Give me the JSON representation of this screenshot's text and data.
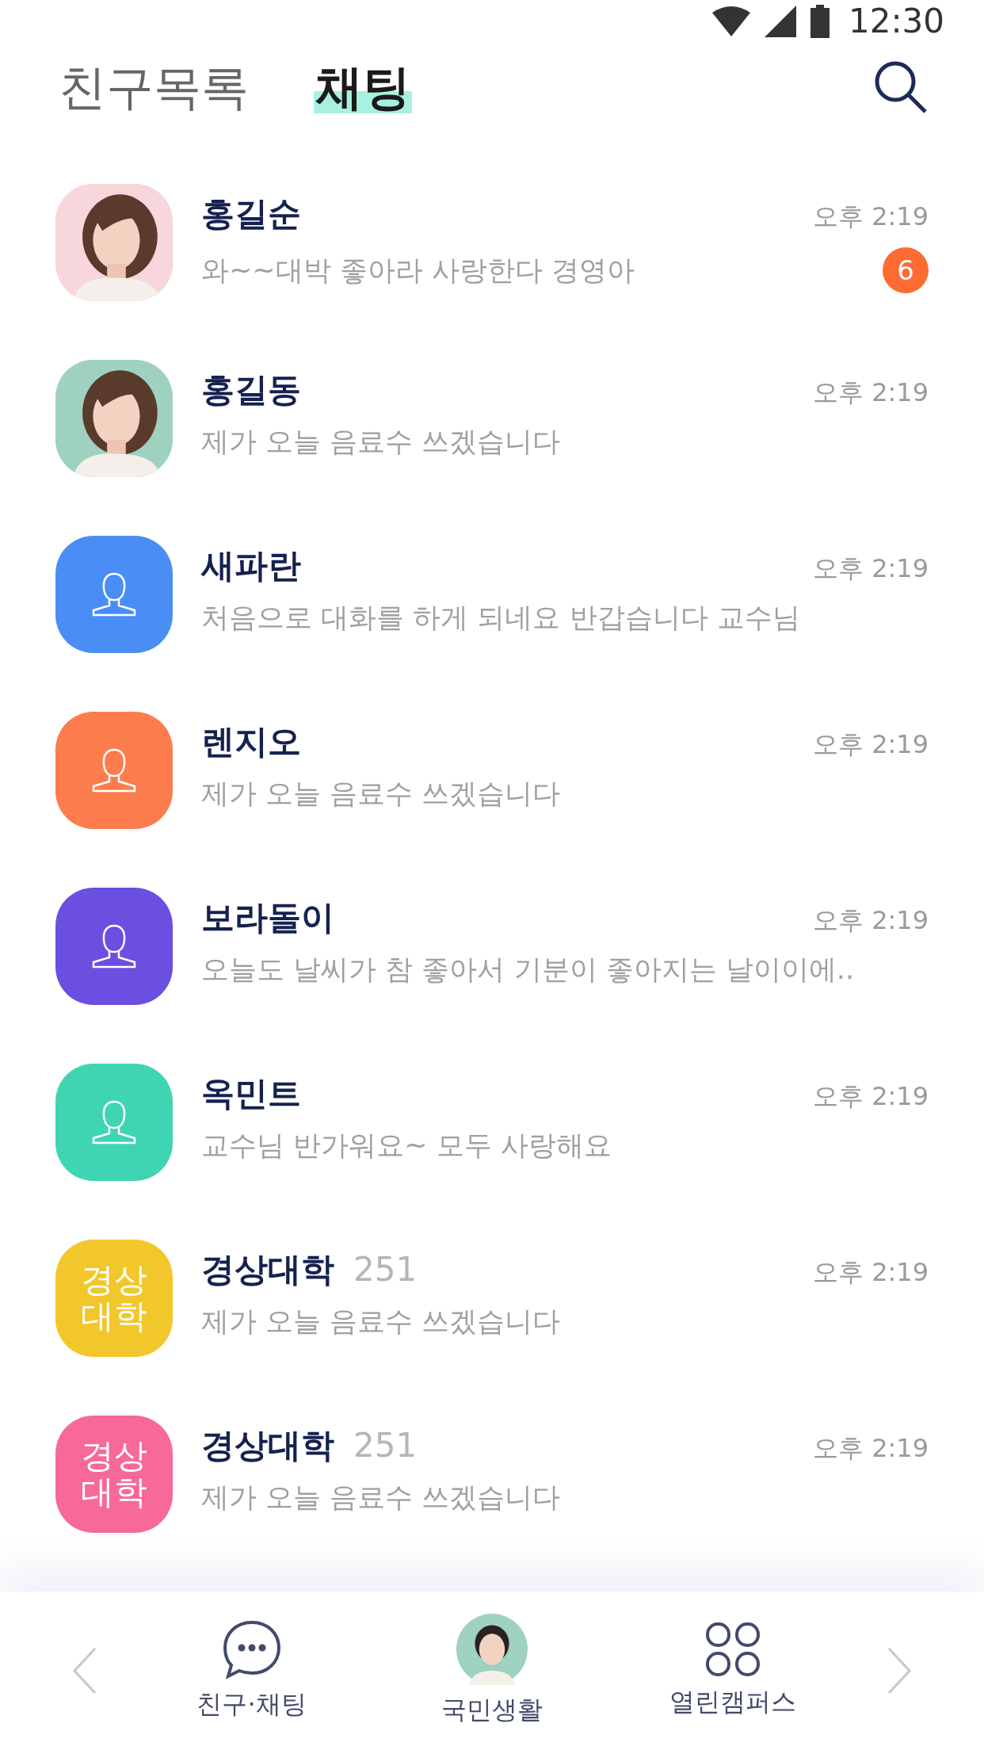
{
  "status_bar": {
    "time": "12:30"
  },
  "tabs": [
    {
      "label": "친구목록",
      "selected": false
    },
    {
      "label": "채팅",
      "selected": true
    }
  ],
  "chats": [
    {
      "name": "홍길순",
      "message": "와~~대박 좋아라 사랑한다 경영아",
      "time": "오후 2:19",
      "unread": "6"
    },
    {
      "name": "홍길동",
      "message": "제가 오늘 음료수 쓰겠습니다",
      "time": "오후 2:19"
    },
    {
      "name": "새파란",
      "message": "처음으로 대화를 하게 되네요 반갑습니다 교수님",
      "time": "오후 2:19",
      "avatar": {
        "kind": "person",
        "color": "#4a8ef5"
      }
    },
    {
      "name": "렌지오",
      "message": "제가 오늘 음료수 쓰겠습니다",
      "time": "오후 2:19",
      "avatar": {
        "kind": "person",
        "color": "#fd7c4d"
      }
    },
    {
      "name": "보라돌이",
      "message": "오늘도 날씨가 참 좋아서 기분이 좋아지는 날이이에..",
      "time": "오후 2:19",
      "avatar": {
        "kind": "person",
        "color": "#6b4fe0"
      }
    },
    {
      "name": "옥민트",
      "message": "교수님 반가워요~ 모두 사랑해요",
      "time": "오후 2:19",
      "avatar": {
        "kind": "person",
        "color": "#3fd5b2"
      }
    },
    {
      "name": "경상대학",
      "count": "251",
      "message": "제가 오늘 음료수 쓰겠습니다",
      "time": "오후 2:19",
      "avatar": {
        "kind": "text",
        "color": "#f1c72c",
        "lines": [
          "경상",
          "대학"
        ]
      }
    },
    {
      "name": "경상대학",
      "count": "251",
      "message": "제가 오늘 음료수 쓰겠습니다",
      "time": "오후 2:19",
      "avatar": {
        "kind": "text",
        "color": "#f6699a",
        "lines": [
          "경상",
          "대학"
        ]
      }
    }
  ],
  "bottom_nav": [
    {
      "label": "친구·채팅",
      "kind": "chat"
    },
    {
      "label": "국민생활",
      "kind": "picture"
    },
    {
      "label": "열린캠퍼스",
      "kind": "grid"
    }
  ]
}
